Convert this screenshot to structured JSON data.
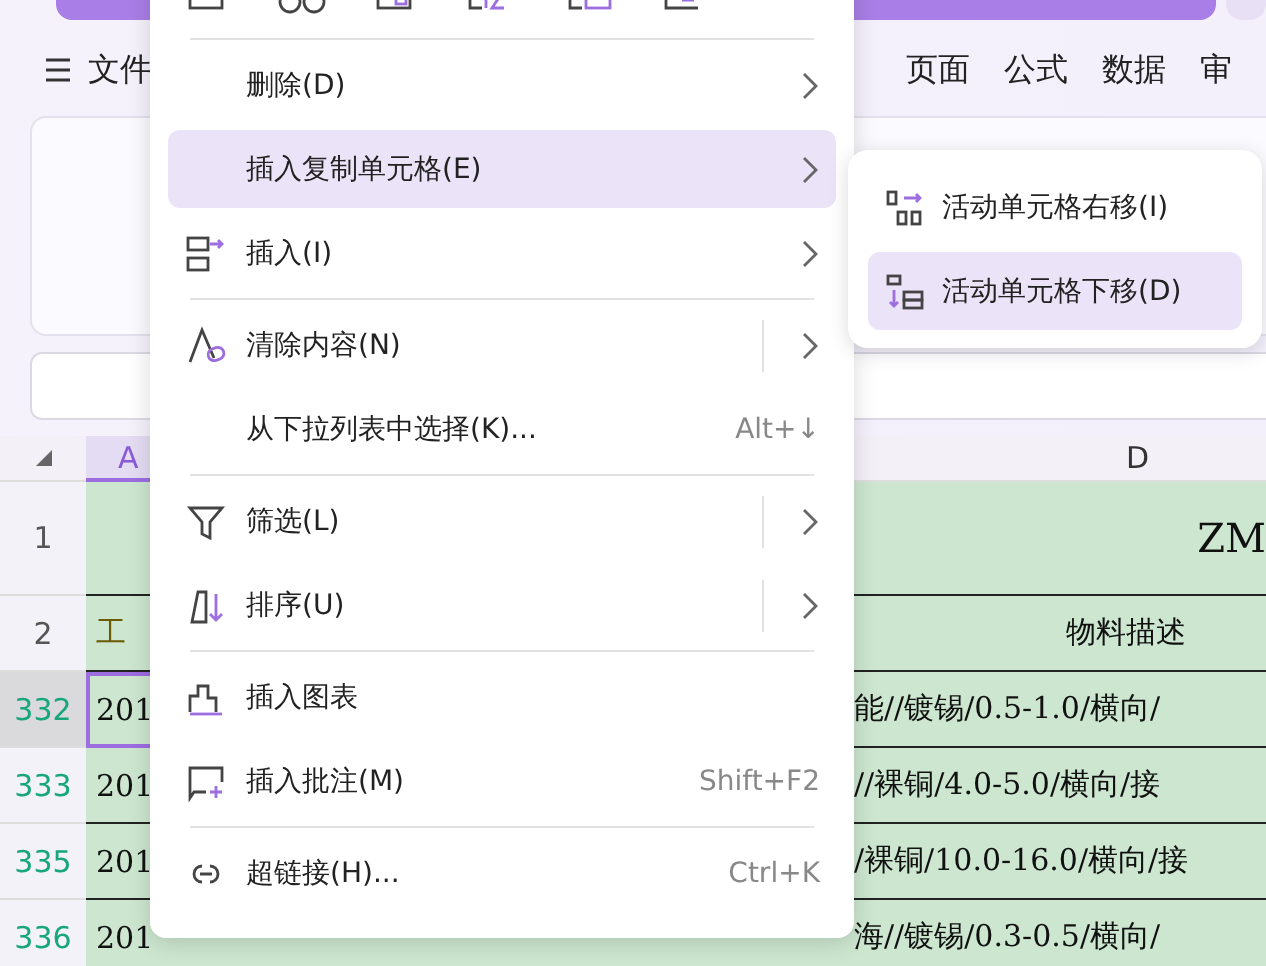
{
  "ribbon": {
    "file_tab": "文件",
    "tabs": [
      {
        "label": "页面"
      },
      {
        "label": "公式"
      },
      {
        "label": "数据"
      },
      {
        "label": "审"
      }
    ]
  },
  "sheet": {
    "columns": [
      {
        "label": "A",
        "selected": true
      },
      {
        "label": "D",
        "selected": false
      }
    ],
    "rows": [
      {
        "header": "1",
        "kind": "title",
        "filtered": false,
        "selected": false,
        "a": "",
        "d": "ZM"
      },
      {
        "header": "2",
        "kind": "heading",
        "filtered": false,
        "selected": false,
        "a": "工",
        "d": "物料描述"
      },
      {
        "header": "332",
        "kind": "data",
        "filtered": true,
        "selected": true,
        "a": "201",
        "d": "能//镀锡/0.5-1.0/横向/"
      },
      {
        "header": "333",
        "kind": "data",
        "filtered": true,
        "selected": false,
        "a": "201",
        "d": "//裸铜/4.0-5.0/横向/接"
      },
      {
        "header": "335",
        "kind": "data",
        "filtered": true,
        "selected": false,
        "a": "201",
        "d": "/裸铜/10.0-16.0/横向/接"
      },
      {
        "header": "336",
        "kind": "data",
        "filtered": true,
        "selected": false,
        "a": "201",
        "d": "海//镀锡/0.3-0.5/横向/"
      }
    ]
  },
  "context_menu": {
    "items": [
      {
        "kind": "icons"
      },
      {
        "kind": "divider"
      },
      {
        "kind": "item",
        "label": "删除(D)",
        "submenu": true,
        "split": false,
        "selected": false
      },
      {
        "kind": "item",
        "label": "插入复制单元格(E)",
        "submenu": true,
        "split": false,
        "selected": true
      },
      {
        "kind": "item",
        "label": "插入(I)",
        "submenu": true,
        "split": false,
        "selected": false
      },
      {
        "kind": "divider"
      },
      {
        "kind": "item",
        "label": "清除内容(N)",
        "submenu": true,
        "split": true,
        "selected": false
      },
      {
        "kind": "item",
        "label": "从下拉列表中选择(K)...",
        "shortcut": "Alt+↓",
        "submenu": false,
        "split": false,
        "selected": false
      },
      {
        "kind": "divider"
      },
      {
        "kind": "item",
        "label": "筛选(L)",
        "submenu": true,
        "split": true,
        "selected": false
      },
      {
        "kind": "item",
        "label": "排序(U)",
        "submenu": true,
        "split": true,
        "selected": false
      },
      {
        "kind": "divider"
      },
      {
        "kind": "item",
        "label": "插入图表",
        "submenu": false,
        "split": false,
        "selected": false
      },
      {
        "kind": "item",
        "label": "插入批注(M)",
        "shortcut": "Shift+F2",
        "submenu": false,
        "split": false,
        "selected": false
      },
      {
        "kind": "divider"
      },
      {
        "kind": "item",
        "label": "超链接(H)...",
        "shortcut": "Ctrl+K",
        "submenu": false,
        "split": false,
        "selected": false
      }
    ]
  },
  "submenu": {
    "items": [
      {
        "label": "活动单元格右移(I)",
        "selected": false
      },
      {
        "label": "活动单元格下移(D)",
        "selected": true
      }
    ]
  }
}
